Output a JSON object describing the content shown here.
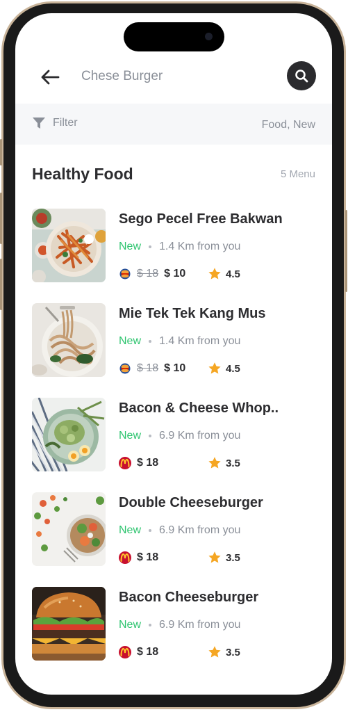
{
  "colors": {
    "accent_new": "#2ec46f",
    "star": "#f5a623",
    "search_button": "#2b2b2e",
    "filter_bg": "#f6f7f9"
  },
  "header": {
    "back_icon": "arrow-left-icon",
    "search_query": "Chese Burger",
    "search_icon": "search-icon"
  },
  "filter": {
    "icon": "funnel-icon",
    "label": "Filter",
    "applied": "Food, New"
  },
  "section": {
    "title": "Healthy Food",
    "count": "5 Menu"
  },
  "items": [
    {
      "name": "Sego Pecel Free Bakwan",
      "tag": "New",
      "distance": "1.4 Km from you",
      "brand_icon": "burger-king-logo",
      "old_price": "$ 18",
      "price": "$ 10",
      "rating": "4.5",
      "image": "fries-plate-photo"
    },
    {
      "name": "Mie Tek Tek Kang Mus",
      "tag": "New",
      "distance": "1.4 Km from you",
      "brand_icon": "burger-king-logo",
      "old_price": "$ 18",
      "price": "$ 10",
      "rating": "4.5",
      "image": "noodles-photo"
    },
    {
      "name": "Bacon & Cheese Whop..",
      "tag": "New",
      "distance": "6.9 Km from you",
      "brand_icon": "mcdonalds-logo",
      "old_price": "",
      "price": "$ 18",
      "rating": "3.5",
      "image": "salad-bowl-photo"
    },
    {
      "name": "Double Cheeseburger",
      "tag": "New",
      "distance": "6.9 Km from you",
      "brand_icon": "mcdonalds-logo",
      "old_price": "",
      "price": "$ 18",
      "rating": "3.5",
      "image": "veggie-bowl-photo"
    },
    {
      "name": "Bacon Cheeseburger",
      "tag": "New",
      "distance": "6.9 Km from you",
      "brand_icon": "mcdonalds-logo",
      "old_price": "",
      "price": "$ 18",
      "rating": "3.5",
      "image": "burger-photo"
    }
  ]
}
